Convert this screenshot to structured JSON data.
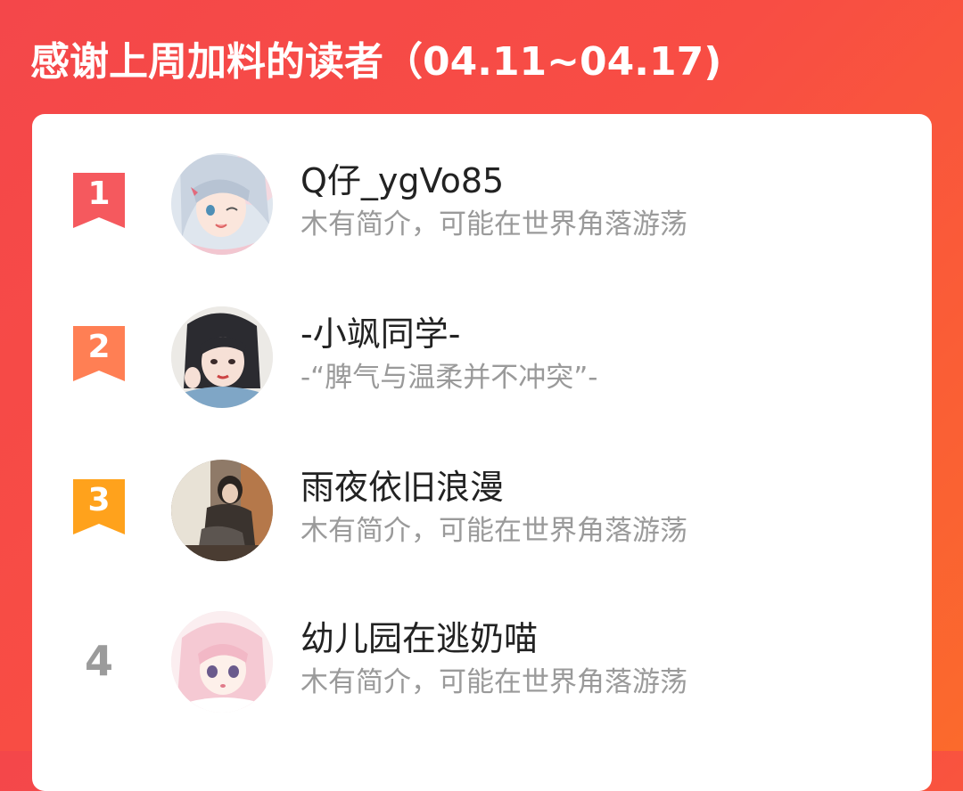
{
  "header": {
    "title": "感谢上周加料的读者（04.11~04.17)"
  },
  "colors": {
    "background_start": "#f4474a",
    "background_end": "#fb6a2c",
    "rank1": "#f5595e",
    "rank2": "#ff7f54",
    "rank3": "#ffa21c",
    "rank_plain": "#9b9b9b",
    "bio_text": "#9a9a9a"
  },
  "leaderboard": [
    {
      "rank": "1",
      "name": "Q仔_ygVo85",
      "bio": "木有简介，可能在世界角落游荡",
      "avatar_icon": "anime-girl-avatar"
    },
    {
      "rank": "2",
      "name": "-小飒同学-",
      "bio": "-“脾气与温柔并不冲突”-",
      "avatar_icon": "illustrated-girl-avatar"
    },
    {
      "rank": "3",
      "name": "雨夜依旧浪漫",
      "bio": "木有简介，可能在世界角落游荡",
      "avatar_icon": "photo-person-avatar"
    },
    {
      "rank": "4",
      "name": "幼儿园在逃奶喵",
      "bio": "木有简介，可能在世界角落游荡",
      "avatar_icon": "pink-hair-anime-avatar"
    }
  ]
}
